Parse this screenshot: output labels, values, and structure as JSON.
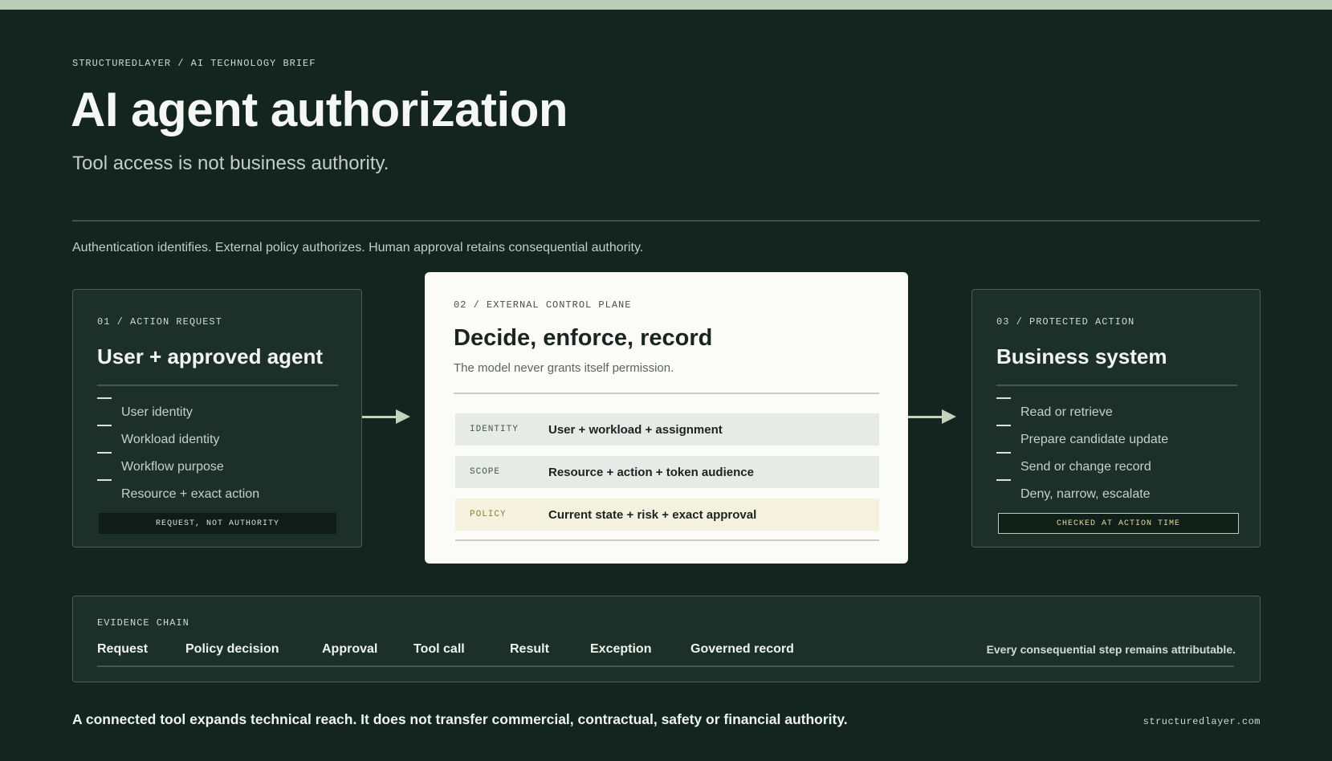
{
  "kicker": "STRUCTUREDLAYER / AI TECHNOLOGY BRIEF",
  "title": "AI agent authorization",
  "subtitle": "Tool access is not business authority.",
  "lede": "Authentication identifies. External policy authorizes. Human approval retains consequential authority.",
  "card1": {
    "label": "01 / ACTION REQUEST",
    "heading": "User + approved agent",
    "items": [
      "User identity",
      "Workload identity",
      "Workflow purpose",
      "Resource + exact action"
    ],
    "tag": "REQUEST, NOT AUTHORITY"
  },
  "card2": {
    "label": "02 / EXTERNAL CONTROL PLANE",
    "heading": "Decide, enforce, record",
    "sub": "The model never grants itself permission.",
    "rows": [
      {
        "key": "IDENTITY",
        "value": "User + workload + assignment"
      },
      {
        "key": "SCOPE",
        "value": "Resource + action + token audience"
      },
      {
        "key": "POLICY",
        "value": "Current state + risk + exact approval"
      }
    ]
  },
  "card3": {
    "label": "03 / PROTECTED ACTION",
    "heading": "Business system",
    "items": [
      "Read or retrieve",
      "Prepare candidate update",
      "Send or change record",
      "Deny, narrow, escalate"
    ],
    "tag": "CHECKED AT ACTION TIME"
  },
  "evidence": {
    "label": "EVIDENCE CHAIN",
    "steps": [
      "Request",
      "Policy decision",
      "Approval",
      "Tool call",
      "Result",
      "Exception",
      "Governed record"
    ],
    "note": "Every consequential step remains attributable."
  },
  "footer": "A connected tool expands technical reach. It does not transfer commercial, contractual, safety or financial authority.",
  "site": "structuredlayer.com",
  "colors": {
    "background": "#14241e",
    "card_dark": "#1c3029",
    "card_light": "#fbfbf8",
    "accent": "#bccfb6",
    "policy_highlight": "#f4f1df"
  }
}
